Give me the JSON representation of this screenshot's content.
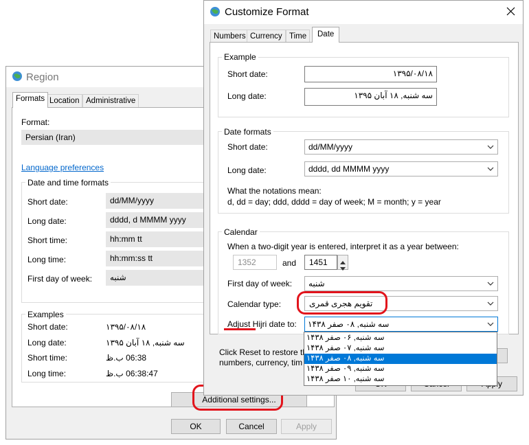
{
  "region": {
    "title": "Region",
    "tabs": [
      "Formats",
      "Location",
      "Administrative"
    ],
    "format_label": "Format:",
    "format_value": "Persian (Iran)",
    "language_link": "Language preferences",
    "dt_group_title": "Date and time formats",
    "rows": [
      {
        "label": "Short date:",
        "value": "dd/MM/yyyy"
      },
      {
        "label": "Long date:",
        "value": "dddd, d MMMM yyyy"
      },
      {
        "label": "Short time:",
        "value": "hh:mm tt"
      },
      {
        "label": "Long time:",
        "value": "hh:mm:ss tt"
      },
      {
        "label": "First day of week:",
        "value": "شنبه"
      }
    ],
    "examples_title": "Examples",
    "examples": [
      {
        "label": "Short date:",
        "value": "۱۳۹۵/۰۸/۱۸"
      },
      {
        "label": "Long date:",
        "value": "سه شنبه, ۱۸ آبان ۱۳۹۵"
      },
      {
        "label": "Short time:",
        "value": "06:38 ب.ظ"
      },
      {
        "label": "Long time:",
        "value": "06:38:47 ب.ظ"
      }
    ],
    "additional_settings": "Additional settings...",
    "ok": "OK",
    "cancel": "Cancel",
    "apply": "Apply"
  },
  "customize": {
    "title": "Customize Format",
    "tabs": [
      "Numbers",
      "Currency",
      "Time",
      "Date"
    ],
    "example_title": "Example",
    "short_date_label": "Short date:",
    "short_date_example": "۱۳۹۵/۰۸/۱۸",
    "long_date_label": "Long date:",
    "long_date_example": "سه شنبه, ۱۸ آبان ۱۳۹۵",
    "formats_title": "Date formats",
    "short_date_format": "dd/MM/yyyy",
    "long_date_format": "dddd, dd MMMM yyyy",
    "notations_title": "What the notations mean:",
    "notations": "d, dd = day;  ddd, dddd = day of week;  M = month;  y = year",
    "calendar_title": "Calendar",
    "two_digit_text": "When a two-digit year is entered, interpret it as a year between:",
    "year_from": "1352",
    "and_label": "and",
    "year_to": "1451",
    "first_day_label": "First day of week:",
    "first_day_value": "شنبه",
    "calendar_type_label": "Calendar type:",
    "calendar_type_value": "تقویم هجری قمری",
    "adjust_label": "Adjust Hijri date to:",
    "adjust_value": "سه شنبه, ۰۸ صفر ۱۴۳۸",
    "adjust_options": [
      "سه شنبه, ۰۶ صفر ۱۴۳۸",
      "سه شنبه, ۰۷ صفر ۱۴۳۸",
      "سه شنبه, ۰۸ صفر ۱۴۳۸",
      "سه شنبه, ۰۹ صفر ۱۴۳۸",
      "سه شنبه, ۱۰ صفر ۱۴۳۸"
    ],
    "reset_text_1": "Click Reset to restore th",
    "reset_text_2": "numbers, currency, tim",
    "ok": "OK",
    "cancel": "Cancel",
    "apply": "Apply"
  },
  "colors": {
    "accent": "#0078d7",
    "annotation": "#e2141c",
    "link": "#0066cc"
  }
}
